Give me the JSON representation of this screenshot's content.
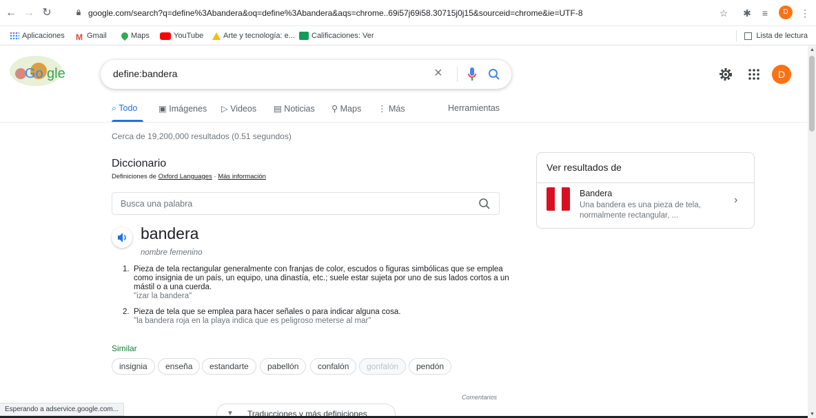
{
  "browser": {
    "url": "google.com/search?q=define%3Abandera&oq=define%3Abandera&aqs=chrome..69i57j69i58.30715j0j15&sourceid=chrome&ie=UTF-8",
    "profile_initial": "D"
  },
  "bookmarks": {
    "items": [
      {
        "label": "Aplicaciones",
        "icon": "apps-grid-icon"
      },
      {
        "label": "Gmail",
        "icon": "gmail-icon"
      },
      {
        "label": "Maps",
        "icon": "maps-pin-icon"
      },
      {
        "label": "YouTube",
        "icon": "youtube-icon"
      },
      {
        "label": "Arte y tecnología: e...",
        "icon": "arts-icon"
      },
      {
        "label": "Calificaciones: Ver",
        "icon": "classroom-icon"
      }
    ],
    "reading_list": "Lista de lectura"
  },
  "search": {
    "query": "define:bandera",
    "profile_initial": "D"
  },
  "tabs": [
    {
      "label": "Todo",
      "active": true
    },
    {
      "label": "Imágenes"
    },
    {
      "label": "Videos"
    },
    {
      "label": "Noticias"
    },
    {
      "label": "Maps"
    },
    {
      "label": "Más"
    },
    {
      "label": "Herramientas"
    }
  ],
  "stats": "Cerca de 19,200,000 resultados (0.51 segundos)",
  "dictionary": {
    "title": "Diccionario",
    "source_prefix": "Definiciones de",
    "source_link": "Oxford Languages",
    "source_sep": "·",
    "more_info": "Más información",
    "word_search_placeholder": "Busca una palabra",
    "word": "bandera",
    "part_of_speech": "nombre femenino",
    "definitions": [
      {
        "num": "1.",
        "text": "Pieza de tela rectangular generalmente con franjas de color, escudos o figuras simbólicas que se emplea como insignia de un país, un equipo, una dinastía, etc.; suele estar sujeta por uno de sus lados cortos a un mástil o a una cuerda.",
        "example": "\"izar la bandera\""
      },
      {
        "num": "2.",
        "text": "Pieza de tela que se emplea para hacer señales o para indicar alguna cosa.",
        "example": "\"la bandera roja en la playa indica que es peligroso meterse al mar\""
      }
    ],
    "similar_title": "Similar",
    "similar": [
      "insignia",
      "enseña",
      "estandarte",
      "pabellón",
      "confalón",
      "gonfalón",
      "pendón"
    ],
    "comments": "Comentarios",
    "more_definitions": "Traducciones y más definiciones"
  },
  "side_panel": {
    "title": "Ver resultados de",
    "result_name": "Bandera",
    "result_desc": "Una bandera es una pieza de tela, normalmente rectangular, ...",
    "flag_colors": [
      "#d91023",
      "#ffffff",
      "#d91023"
    ]
  },
  "status_bar": "Esperando a adservice.google.com...",
  "colors": {
    "accent": "#1a73e8",
    "similar_green": "#188038",
    "avatar_orange": "#f97316"
  }
}
